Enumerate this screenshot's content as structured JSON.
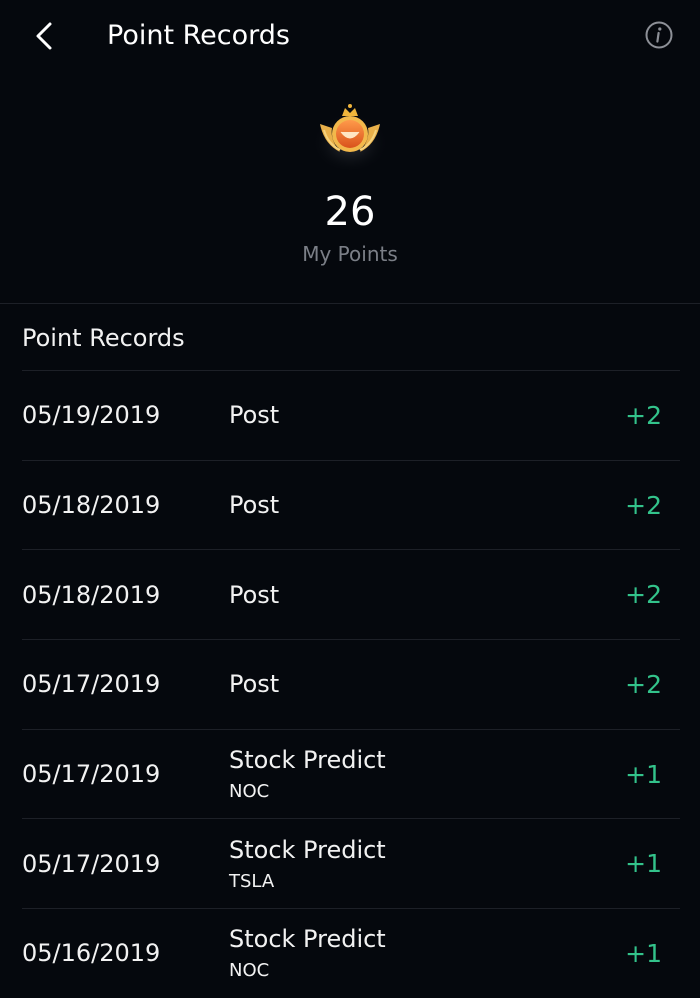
{
  "header": {
    "title": "Point Records",
    "back_icon": "chevron-left-icon",
    "info_icon": "info-icon"
  },
  "summary": {
    "points": "26",
    "label": "My Points",
    "medal_icon": "crowned-medal-icon"
  },
  "records_section": {
    "title": "Point Records",
    "rows": [
      {
        "date": "05/19/2019",
        "type": "Post",
        "sub": "",
        "points": "+2"
      },
      {
        "date": "05/18/2019",
        "type": "Post",
        "sub": "",
        "points": "+2"
      },
      {
        "date": "05/18/2019",
        "type": "Post",
        "sub": "",
        "points": "+2"
      },
      {
        "date": "05/17/2019",
        "type": "Post",
        "sub": "",
        "points": "+2"
      },
      {
        "date": "05/17/2019",
        "type": "Stock Predict",
        "sub": "NOC",
        "points": "+1"
      },
      {
        "date": "05/17/2019",
        "type": "Stock Predict",
        "sub": "TSLA",
        "points": "+1"
      },
      {
        "date": "05/16/2019",
        "type": "Stock Predict",
        "sub": "NOC",
        "points": "+1"
      }
    ]
  },
  "colors": {
    "background": "#05080d",
    "positive_points": "#33c38b",
    "muted_text": "#7b7f87"
  }
}
